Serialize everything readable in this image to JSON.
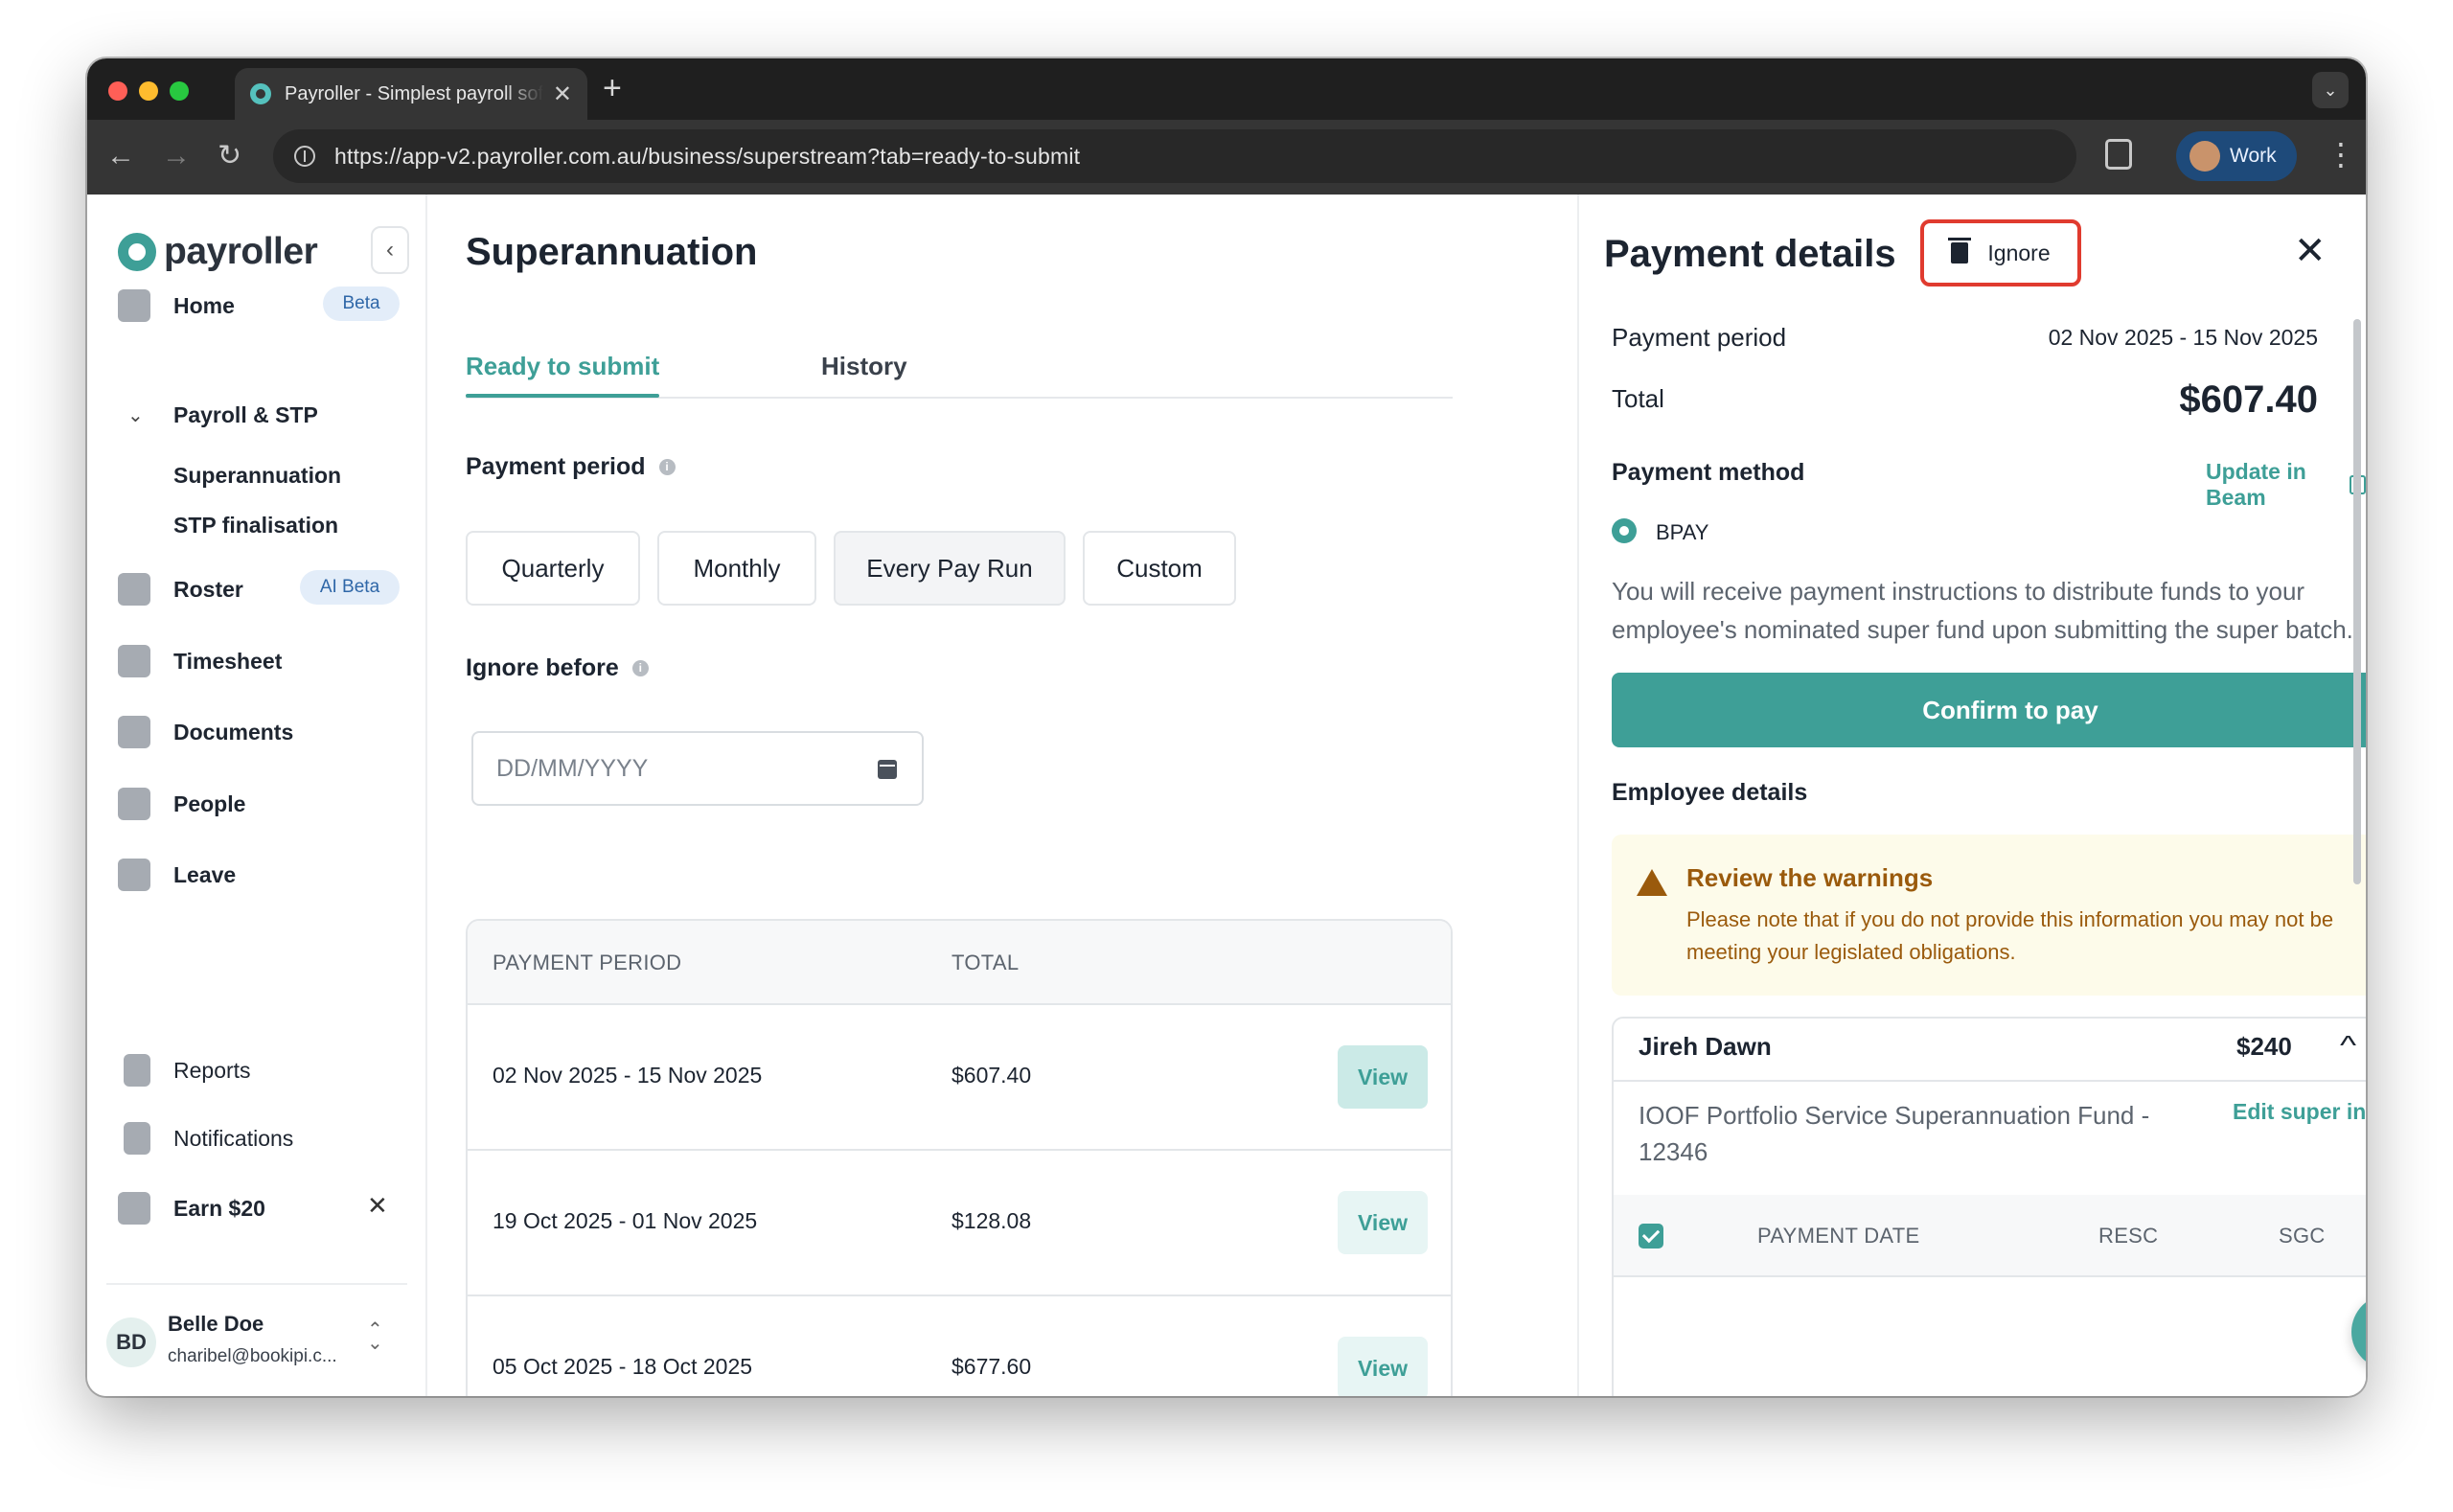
{
  "browser": {
    "tab_title": "Payroller - Simplest payroll software",
    "url": "https://app-v2.payroller.com.au/business/superstream?tab=ready-to-submit",
    "profile_label": "Work",
    "traffic_colors": [
      "#ff5f57",
      "#febc2e",
      "#28c840"
    ]
  },
  "sidebar": {
    "logo": "payroller",
    "items": [
      {
        "label": "Home",
        "badge": "Beta",
        "icon": "home-icon"
      },
      {
        "label": "Payroll & STP",
        "icon": "chevron-down-icon"
      },
      {
        "label": "Roster",
        "badge": "AI Beta",
        "icon": "roster-icon"
      },
      {
        "label": "Timesheet",
        "icon": "timesheet-icon"
      },
      {
        "label": "Documents",
        "icon": "documents-icon"
      },
      {
        "label": "People",
        "icon": "people-icon"
      },
      {
        "label": "Leave",
        "icon": "leave-icon"
      },
      {
        "label": "Reports",
        "icon": "reports-icon"
      },
      {
        "label": "Notifications",
        "icon": "bell-icon"
      },
      {
        "label": "Earn $20",
        "icon": "gift-icon"
      }
    ],
    "sub_items": [
      "Superannuation",
      "STP finalisation"
    ],
    "user": {
      "initials": "BD",
      "name": "Belle Doe",
      "email": "charibel@bookipi.c..."
    }
  },
  "main": {
    "title": "Superannuation",
    "tabs": [
      {
        "label": "Ready to submit",
        "active": true
      },
      {
        "label": "History",
        "active": false
      }
    ],
    "payment_period_label": "Payment period",
    "period_options": [
      {
        "label": "Quarterly",
        "selected": false
      },
      {
        "label": "Monthly",
        "selected": false
      },
      {
        "label": "Every Pay Run",
        "selected": true
      },
      {
        "label": "Custom",
        "selected": false
      }
    ],
    "ignore_before_label": "Ignore before",
    "date_placeholder": "DD/MM/YYYY",
    "table": {
      "headers": [
        "PAYMENT PERIOD",
        "TOTAL"
      ],
      "view_label": "View",
      "rows": [
        {
          "period": "02 Nov 2025 - 15 Nov 2025",
          "total": "$607.40"
        },
        {
          "period": "19 Oct 2025 - 01 Nov 2025",
          "total": "$128.08"
        },
        {
          "period": "05 Oct 2025 - 18 Oct 2025",
          "total": "$677.60"
        }
      ]
    }
  },
  "panel": {
    "title": "Payment details",
    "ignore_label": "Ignore",
    "payment_period_label": "Payment period",
    "payment_period_value": "02 Nov 2025 - 15 Nov 2025",
    "total_label": "Total",
    "total_value": "$607.40",
    "payment_method_label": "Payment method",
    "update_link": "Update in Beam",
    "method_option": "BPAY",
    "instructions": "You will receive payment instructions to distribute funds to your employee's nominated super fund upon submitting the super batch.",
    "confirm_label": "Confirm to pay",
    "employee_details_label": "Employee details",
    "warning": {
      "title": "Review the warnings",
      "text": "Please note that if you do not provide this information you may not be meeting your legislated obligations."
    },
    "employee": {
      "name": "Jireh Dawn",
      "amount": "$240",
      "fund": "IOOF Portfolio Service Superannuation Fund - 12346",
      "edit_label": "Edit super info",
      "columns": [
        "PAYMENT DATE",
        "RESC",
        "SGC"
      ]
    }
  },
  "colors": {
    "accent": "#3e9f97",
    "highlight": "#e03b2f",
    "warning": "#9a5a0c"
  }
}
